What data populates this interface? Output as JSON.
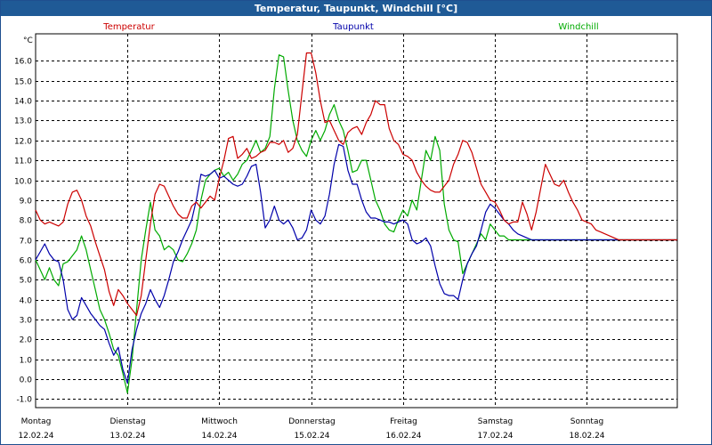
{
  "title": "Temperatur, Taupunkt, Windchill [°C]",
  "chart_data": {
    "type": "line",
    "title": "Temperatur, Taupunkt, Windchill [°C]",
    "ylabel": "°C",
    "xlabel": "",
    "ylim": [
      -1.5,
      17.2
    ],
    "yticks": [
      -1.0,
      0.0,
      1.0,
      2.0,
      3.0,
      4.0,
      5.0,
      6.0,
      7.0,
      8.0,
      9.0,
      10.0,
      11.0,
      12.0,
      13.0,
      14.0,
      15.0,
      16.0
    ],
    "ytick_labels": [
      "-1.0",
      "0.0",
      "1.0",
      "2.0",
      "3.0",
      "4.0",
      "5.0",
      "6.0",
      "7.0",
      "8.0",
      "9.0",
      "10.0",
      "11.0",
      "12.0",
      "13.0",
      "14.0",
      "15.0",
      "16.0"
    ],
    "grid": true,
    "legend": "top",
    "xlim": [
      0,
      7.0
    ],
    "day_labels": [
      {
        "day": "Montag",
        "date": "12.02.24"
      },
      {
        "day": "Dienstag",
        "date": "13.02.24"
      },
      {
        "day": "Mittwoch",
        "date": "14.02.24"
      },
      {
        "day": "Donnerstag",
        "date": "15.02.24"
      },
      {
        "day": "Freitag",
        "date": "16.02.24"
      },
      {
        "day": "Samstag",
        "date": "17.02.24"
      },
      {
        "day": "Sonntag",
        "date": "18.02.24"
      }
    ],
    "series": [
      {
        "name": "Temperatur",
        "color": "#cc0000",
        "x": [
          0,
          0.05,
          0.1,
          0.15,
          0.2,
          0.25,
          0.3,
          0.35,
          0.4,
          0.45,
          0.5,
          0.55,
          0.6,
          0.65,
          0.7,
          0.75,
          0.8,
          0.85,
          0.9,
          0.95,
          1.0,
          1.05,
          1.1,
          1.15,
          1.2,
          1.25,
          1.3,
          1.35,
          1.4,
          1.45,
          1.5,
          1.55,
          1.6,
          1.65,
          1.7,
          1.75,
          1.8,
          1.85,
          1.9,
          1.95,
          2.0,
          2.05,
          2.1,
          2.15,
          2.2,
          2.25,
          2.3,
          2.35,
          2.4,
          2.45,
          2.5,
          2.55,
          2.6,
          2.65,
          2.7,
          2.75,
          2.8,
          2.85,
          2.9,
          2.95,
          3.0,
          3.05,
          3.1,
          3.15,
          3.2,
          3.25,
          3.3,
          3.35,
          3.4,
          3.45,
          3.5,
          3.55,
          3.6,
          3.65,
          3.7,
          3.75,
          3.8,
          3.85,
          3.9,
          3.95,
          4.0,
          4.05,
          4.1,
          4.15,
          4.2,
          4.25,
          4.3,
          4.35,
          4.4,
          4.45,
          4.5,
          4.55,
          4.6,
          4.65,
          4.7,
          4.75,
          4.8,
          4.85,
          4.9,
          4.95,
          5.0,
          5.05,
          5.1,
          5.15,
          5.2,
          5.25,
          5.3,
          5.35,
          5.4,
          5.45,
          5.5,
          5.55,
          5.6,
          5.65,
          5.7,
          5.75,
          5.8,
          5.85,
          5.9,
          5.95,
          6.0,
          6.05,
          6.1,
          6.15,
          6.2,
          6.25,
          6.3,
          6.35,
          6.4,
          6.45,
          6.5,
          6.55,
          6.6,
          6.65,
          6.7,
          6.75,
          6.8,
          6.85,
          6.9,
          6.95,
          7.0
        ],
        "values": [
          8.5,
          8.0,
          7.8,
          7.9,
          7.8,
          7.7,
          7.9,
          8.8,
          9.4,
          9.5,
          9.0,
          8.2,
          7.7,
          6.9,
          6.2,
          5.5,
          4.4,
          3.7,
          4.5,
          4.2,
          3.8,
          3.5,
          3.2,
          4.2,
          6.0,
          7.8,
          9.3,
          9.8,
          9.7,
          9.2,
          8.7,
          8.3,
          8.1,
          8.1,
          8.7,
          8.9,
          8.6,
          8.9,
          9.2,
          9.0,
          10.1,
          11.0,
          12.1,
          12.2,
          11.1,
          11.3,
          11.6,
          11.1,
          11.2,
          11.4,
          11.5,
          11.9,
          11.9,
          11.8,
          12.0,
          11.4,
          11.6,
          12.3,
          14.4,
          16.4,
          16.4,
          15.4,
          14.0,
          12.9,
          13.0,
          12.5,
          12.0,
          11.8,
          12.4,
          12.6,
          12.7,
          12.3,
          12.9,
          13.3,
          14.0,
          13.8,
          13.8,
          12.6,
          12.0,
          11.8,
          11.3,
          11.2,
          11.0,
          10.4,
          10.0,
          9.7,
          9.5,
          9.4,
          9.4,
          9.7,
          10.0,
          10.8,
          11.3,
          12.0,
          11.9,
          11.4,
          10.6,
          9.8,
          9.4,
          9.0,
          8.9,
          8.5,
          8.0,
          7.8,
          7.9,
          7.9,
          8.9,
          8.3,
          7.5,
          8.4,
          9.6,
          10.8,
          10.3,
          9.8,
          9.7,
          10.0,
          9.4,
          8.9,
          8.5,
          8.0,
          7.9,
          7.8,
          7.5,
          7.4,
          7.3,
          7.2,
          7.1,
          7.0,
          7.0,
          7.0,
          7.0,
          7.0,
          7.0,
          7.0,
          7.0,
          7.0,
          7.0,
          7.0,
          7.0,
          7.0,
          7.0
        ]
      },
      {
        "name": "Taupunkt",
        "color": "#0000aa",
        "x": [
          0,
          0.05,
          0.1,
          0.15,
          0.2,
          0.25,
          0.3,
          0.35,
          0.4,
          0.45,
          0.5,
          0.55,
          0.6,
          0.65,
          0.7,
          0.75,
          0.8,
          0.85,
          0.9,
          0.95,
          1.0,
          1.05,
          1.1,
          1.15,
          1.2,
          1.25,
          1.3,
          1.35,
          1.4,
          1.45,
          1.5,
          1.55,
          1.6,
          1.65,
          1.7,
          1.75,
          1.8,
          1.85,
          1.9,
          1.95,
          2.0,
          2.05,
          2.1,
          2.15,
          2.2,
          2.25,
          2.3,
          2.35,
          2.4,
          2.45,
          2.5,
          2.55,
          2.6,
          2.65,
          2.7,
          2.75,
          2.8,
          2.85,
          2.9,
          2.95,
          3.0,
          3.05,
          3.1,
          3.15,
          3.2,
          3.25,
          3.3,
          3.35,
          3.4,
          3.45,
          3.5,
          3.55,
          3.6,
          3.65,
          3.7,
          3.75,
          3.8,
          3.85,
          3.9,
          3.95,
          4.0,
          4.05,
          4.1,
          4.15,
          4.2,
          4.25,
          4.3,
          4.35,
          4.4,
          4.45,
          4.5,
          4.55,
          4.6,
          4.65,
          4.7,
          4.75,
          4.8,
          4.85,
          4.9,
          4.95,
          5.0,
          5.05,
          5.1,
          5.15,
          5.2,
          5.25,
          5.3,
          5.35,
          5.4,
          5.45,
          5.5,
          5.55,
          5.6,
          5.65,
          5.7,
          5.75,
          5.8,
          5.85,
          5.9,
          5.95,
          6.0,
          6.05,
          6.1,
          6.15,
          6.2,
          6.25,
          6.3,
          6.35,
          6.4,
          6.45,
          6.5,
          6.55,
          6.6,
          6.65,
          6.7,
          6.75,
          6.8,
          6.85,
          6.9,
          6.95,
          7.0
        ],
        "values": [
          6.0,
          6.4,
          6.8,
          6.3,
          6.0,
          5.9,
          5.0,
          3.5,
          3.0,
          3.2,
          4.1,
          3.7,
          3.3,
          3.0,
          2.7,
          2.5,
          1.8,
          1.2,
          1.6,
          0.5,
          -0.2,
          1.5,
          2.5,
          3.3,
          3.8,
          4.5,
          4.0,
          3.6,
          4.2,
          5.0,
          5.9,
          6.4,
          7.0,
          7.5,
          8.0,
          9.0,
          10.3,
          10.2,
          10.3,
          10.5,
          10.1,
          10.2,
          10.0,
          9.8,
          9.7,
          9.8,
          10.2,
          10.7,
          10.8,
          9.4,
          7.6,
          8.0,
          8.7,
          8.0,
          7.8,
          8.0,
          7.6,
          7.0,
          7.1,
          7.5,
          8.5,
          8.0,
          7.8,
          8.2,
          9.3,
          10.8,
          11.8,
          11.7,
          10.5,
          9.8,
          9.8,
          9.0,
          8.4,
          8.1,
          8.1,
          8.0,
          7.9,
          7.9,
          7.8,
          7.9,
          8.0,
          7.8,
          7.0,
          6.8,
          6.9,
          7.1,
          6.7,
          5.7,
          4.8,
          4.3,
          4.2,
          4.2,
          4.0,
          5.0,
          5.8,
          6.3,
          6.7,
          7.5,
          8.4,
          8.8,
          8.6,
          8.3,
          8.0,
          7.8,
          7.5,
          7.3,
          7.2,
          7.1,
          7.0,
          7.0,
          7.0,
          7.0,
          7.0,
          7.0,
          7.0,
          7.0,
          7.0,
          7.0,
          7.0,
          7.0,
          7.0,
          7.0,
          7.0,
          7.0,
          7.0,
          7.0,
          7.0,
          7.0,
          7.0,
          7.0,
          7.0,
          7.0,
          7.0,
          7.0,
          7.0,
          7.0,
          7.0,
          7.0,
          7.0,
          7.0,
          7.0
        ]
      },
      {
        "name": "Windchill",
        "color": "#00aa00",
        "x": [
          0,
          0.05,
          0.1,
          0.15,
          0.2,
          0.25,
          0.3,
          0.35,
          0.4,
          0.45,
          0.5,
          0.55,
          0.6,
          0.65,
          0.7,
          0.75,
          0.8,
          0.85,
          0.9,
          0.95,
          1.0,
          1.05,
          1.1,
          1.15,
          1.2,
          1.25,
          1.3,
          1.35,
          1.4,
          1.45,
          1.5,
          1.55,
          1.6,
          1.65,
          1.7,
          1.75,
          1.8,
          1.85,
          1.9,
          1.95,
          2.0,
          2.05,
          2.1,
          2.15,
          2.2,
          2.25,
          2.3,
          2.35,
          2.4,
          2.45,
          2.5,
          2.55,
          2.6,
          2.65,
          2.7,
          2.75,
          2.8,
          2.85,
          2.9,
          2.95,
          3.0,
          3.05,
          3.1,
          3.15,
          3.2,
          3.25,
          3.3,
          3.35,
          3.4,
          3.45,
          3.5,
          3.55,
          3.6,
          3.65,
          3.7,
          3.75,
          3.8,
          3.85,
          3.9,
          3.95,
          4.0,
          4.05,
          4.1,
          4.15,
          4.2,
          4.25,
          4.3,
          4.35,
          4.4,
          4.45,
          4.5,
          4.55,
          4.6,
          4.65,
          4.7,
          4.75,
          4.8,
          4.85,
          4.9,
          4.95,
          5.0,
          5.05,
          5.1,
          5.15,
          5.2,
          5.25,
          5.3,
          5.35,
          5.4,
          5.45,
          5.5,
          5.55,
          5.6,
          5.65,
          5.7,
          5.75,
          5.8,
          5.85,
          5.9,
          5.95,
          6.0,
          6.05,
          6.1,
          6.15,
          6.2,
          6.25,
          6.3,
          6.35,
          6.4,
          6.45,
          6.5,
          6.55,
          6.6,
          6.65,
          6.7,
          6.75,
          6.8,
          6.85,
          6.9,
          6.95,
          7.0
        ],
        "values": [
          6.0,
          5.5,
          5.0,
          5.6,
          5.0,
          4.7,
          5.8,
          5.9,
          6.2,
          6.5,
          7.2,
          6.5,
          5.5,
          4.5,
          3.5,
          3.0,
          2.3,
          1.5,
          1.2,
          0.3,
          -0.7,
          1.0,
          3.5,
          6.0,
          7.5,
          8.9,
          7.5,
          7.2,
          6.5,
          6.7,
          6.5,
          6.0,
          5.9,
          6.3,
          6.8,
          7.5,
          9.0,
          10.0,
          10.3,
          10.5,
          10.6,
          10.2,
          10.4,
          10.0,
          10.3,
          10.8,
          11.0,
          11.5,
          12.0,
          11.4,
          11.6,
          12.2,
          14.6,
          16.3,
          16.2,
          14.5,
          13.0,
          12.0,
          11.5,
          11.2,
          12.0,
          12.5,
          12.0,
          12.5,
          13.3,
          13.8,
          13.0,
          12.5,
          11.5,
          10.4,
          10.5,
          11.0,
          11.0,
          10.0,
          9.0,
          8.5,
          7.8,
          7.5,
          7.4,
          8.0,
          8.5,
          8.2,
          9.0,
          8.5,
          10.0,
          11.5,
          11.0,
          12.2,
          11.5,
          8.8,
          7.5,
          7.0,
          6.9,
          5.3,
          5.8,
          6.3,
          6.8,
          7.3,
          7.0,
          7.8,
          7.5,
          7.2,
          7.2,
          7.0,
          7.0,
          7.0,
          7.0,
          7.0,
          7.0,
          7.0,
          7.0,
          7.0,
          7.0,
          7.0,
          7.0,
          7.0,
          7.0,
          7.0,
          7.0,
          7.0,
          7.0,
          7.0,
          7.0,
          7.0,
          7.0,
          7.0,
          7.0,
          7.0,
          7.0,
          7.0,
          7.0,
          7.0,
          7.0,
          7.0,
          7.0,
          7.0,
          7.0,
          7.0,
          7.0,
          7.0,
          7.0
        ]
      }
    ]
  }
}
